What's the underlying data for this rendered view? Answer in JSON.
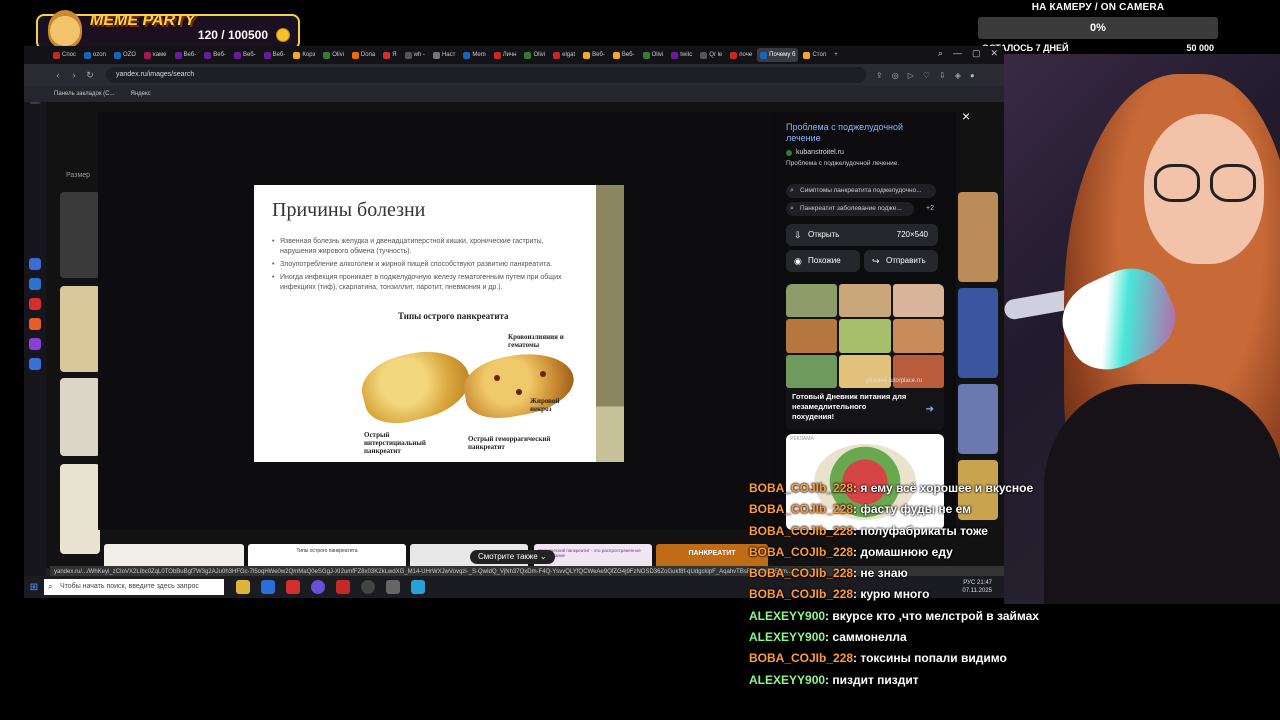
{
  "overlay": {
    "meme_title": "MEME PARTY",
    "meme_count": "120 / 100500",
    "goal_label": "НА КАМЕРУ / ON CAMERA",
    "goal_percent": "0%",
    "goal_remaining": "ОСТАЛОСЬ 7 ДНЕЙ",
    "goal_target": "50 000"
  },
  "browser": {
    "tabs": [
      {
        "label": "Спос",
        "color": "#c62828"
      },
      {
        "label": "ozon",
        "color": "#1565c0"
      },
      {
        "label": "OZO",
        "color": "#1565c0"
      },
      {
        "label": "каме",
        "color": "#ad1457"
      },
      {
        "label": "Веб-",
        "color": "#6a1b9a"
      },
      {
        "label": "Веб-",
        "color": "#6a1b9a"
      },
      {
        "label": "Веб-",
        "color": "#6a1b9a"
      },
      {
        "label": "Веб-",
        "color": "#6a1b9a"
      },
      {
        "label": "Корз",
        "color": "#f9a825"
      },
      {
        "label": "Olivi",
        "color": "#2e7d32"
      },
      {
        "label": "Dona",
        "color": "#ef6c00"
      },
      {
        "label": "Я",
        "color": "#d32f2f"
      },
      {
        "label": "wh -",
        "color": "#555"
      },
      {
        "label": "Наст",
        "color": "#777"
      },
      {
        "label": "Mem",
        "color": "#1565c0"
      },
      {
        "label": "Личн",
        "color": "#c62828"
      },
      {
        "label": "Olivi",
        "color": "#2e7d32"
      },
      {
        "label": "elgat",
        "color": "#c62828"
      },
      {
        "label": "Веб-",
        "color": "#f9a825"
      },
      {
        "label": "Веб-",
        "color": "#f9a825"
      },
      {
        "label": "Olivi",
        "color": "#2e7d32"
      },
      {
        "label": "twitc",
        "color": "#6a1b9a"
      },
      {
        "label": "Qr le",
        "color": "#555"
      },
      {
        "label": "поче",
        "color": "#c62828"
      },
      {
        "label": "Почему б",
        "color": "#1565c0"
      },
      {
        "label": "Стол",
        "color": "#f9a825"
      }
    ],
    "url": "yandex.ru/images/search",
    "bookmark_1": "Панель закладок (С...",
    "bookmark_2": "Яндекс",
    "size_filter": "Размер",
    "status_url": "yandex.ru/.../WhKeyi_zCIoVX2LIbc0ZqL0TObBuBgf7W3g2AJu0h3HFGc-7l5oqHWe0w2QmMaQ0eSGgJ-XI2umfFZ8x03K2kLwdXG_M14-UHrWXJwVovqzi-_S-QwIdQ_VjNh37QxDm-F4Q-YsvvQLYfQCWeAe9QfZG4j9FzNOSD36ZoGukf8f-qUdgckipF_AqahvTBsRjhpG40EE8m..."
  },
  "modal": {
    "close_label": "×",
    "slide_title": "Причины болезни",
    "slide_bullets": [
      "Язвенная болезнь желудка и двенадцатиперстной кишки, хронические гастриты, нарушения жирового обмена (тучность).",
      "Злоупотребление алкоголем и жирной пищей способствуют развитию панкреатита.",
      "Иногда инфекция проникает в поджелудочную железу гематогенным путем при общих инфекциях (тиф), скарлатина, тонзиллит, паротит, пневмония и др.)."
    ],
    "slide_subtitle": "Типы острого панкреатита",
    "label_hemorrhage": "Кровоизлияния и гематомы",
    "label_necrosis": "Жировой некроз",
    "label_interstitial": "Острый интерстициальный панкреатит",
    "label_hemorrhagic": "Острый геморрагический панкреатит",
    "info_title": "Проблема с поджелудочной лечение",
    "info_source": "kubanstroitel.ru",
    "info_desc": "Проблема с поджелудочной лечение.",
    "chip_1": "Симптомы панкреатита поджелудочно...",
    "chip_2": "Панкреатит заболевание поджe...",
    "chip_more": "+2",
    "open_label": "Открыть",
    "open_size": "720×540",
    "similar_label": "Похожие",
    "send_label": "Отправить",
    "ad_badge": "РЕКЛАМА",
    "ad_site": "pitanie4.tutorplace.ru",
    "ad_title": "Готовый Дневник питания для незамедлительного похудения!",
    "see_also": "Смотрите также",
    "strip_2_label": "Типы острого панкреатита",
    "strip_4_label": "Хронический панкреатит - это распространенное заболевание",
    "strip_5_label": "ПАНКРЕАТИТ"
  },
  "taskbar": {
    "search_placeholder": "Чтобы начать поиск, введите здесь запрос",
    "lang": "РУС",
    "time": "21:47",
    "date": "07.11.2025"
  },
  "chat": [
    {
      "user": "BOBA_COJIb_228",
      "text": ": я ему всё хорошее и вкусное",
      "green": false
    },
    {
      "user": "BOBA_COJIb_228",
      "text": ": фасту фуды не ем",
      "green": false
    },
    {
      "user": "BOBA_COJIb_228",
      "text": ": полуфабрикаты тоже",
      "green": false
    },
    {
      "user": "BOBA_COJIb_228",
      "text": ": домашнюю еду",
      "green": false
    },
    {
      "user": "BOBA_COJIb_228",
      "text": ": не знаю",
      "green": false
    },
    {
      "user": "BOBA_COJIb_228",
      "text": ": курю много",
      "green": false
    },
    {
      "user": "ALEXEYY900",
      "text": ": вкурсе кто ,что мелстрой в займах",
      "green": true
    },
    {
      "user": "ALEXEYY900",
      "text": ": саммонелла",
      "green": true
    },
    {
      "user": "BOBA_COJIb_228",
      "text": ": токсины попали видимо",
      "green": false
    },
    {
      "user": "ALEXEYY900",
      "text": ": пиздит пиздит",
      "green": true
    }
  ]
}
